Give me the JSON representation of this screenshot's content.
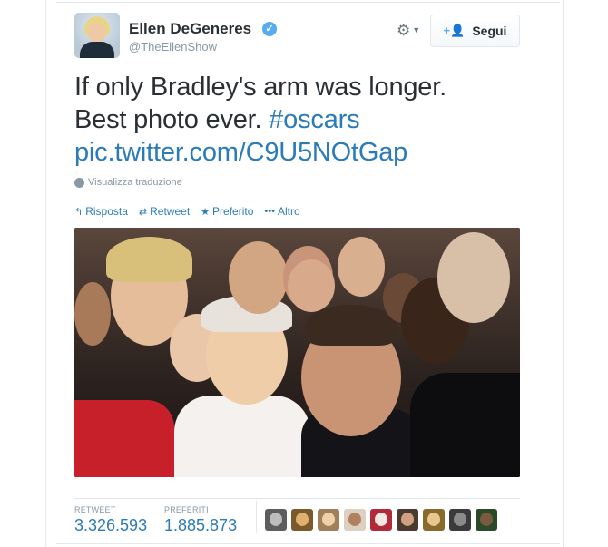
{
  "author": {
    "name": "Ellen DeGeneres",
    "handle": "@TheEllenShow",
    "verified_glyph": "✓"
  },
  "header": {
    "follow_label": "Segui",
    "follow_icon": "user-plus-icon",
    "settings_icon": "gear-icon"
  },
  "tweet": {
    "line1": "If only Bradley's arm was longer.",
    "line2_text": "Best photo ever. ",
    "hashtag": "#oscars",
    "link": "pic.twitter.com/C9U5NOtGap",
    "translate": "Visualizza traduzione"
  },
  "actions": [
    {
      "label": "Risposta",
      "icon": "reply-icon",
      "glyph": "↰"
    },
    {
      "label": "Retweet",
      "icon": "retweet-icon",
      "glyph": "⇄"
    },
    {
      "label": "Preferito",
      "icon": "star-icon",
      "glyph": "★"
    },
    {
      "label": "Altro",
      "icon": "more-icon",
      "glyph": "•••"
    }
  ],
  "stats": {
    "retweet_label": "RETWEET",
    "retweet_value": "3.326.593",
    "favorites_label": "PREFERITI",
    "favorites_value": "1.885.873"
  },
  "colors": {
    "link": "#2b7bb9",
    "verified": "#55acee",
    "muted": "#8899a6",
    "text": "#292f33"
  }
}
